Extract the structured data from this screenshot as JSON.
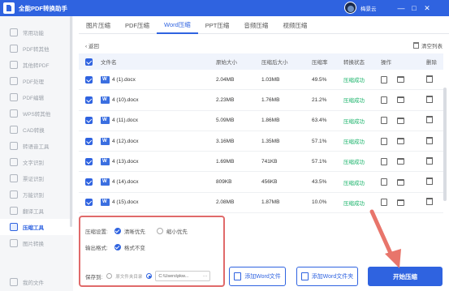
{
  "app": {
    "title": "全能PDF转换助手",
    "username": "梅景云"
  },
  "window": {
    "buttons": [
      "—",
      "□",
      "✕"
    ]
  },
  "sidebar": {
    "items": [
      {
        "label": "常用功能",
        "active": false
      },
      {
        "label": "PDF转其他",
        "active": false
      },
      {
        "label": "其他转PDF",
        "active": false
      },
      {
        "label": "PDF处理",
        "active": false
      },
      {
        "label": "PDF编辑",
        "active": false
      },
      {
        "label": "WPS转其他",
        "active": false
      },
      {
        "label": "CAD转换",
        "active": false
      },
      {
        "label": "转语音工具",
        "active": false
      },
      {
        "label": "文字识别",
        "active": false
      },
      {
        "label": "票证识别",
        "active": false
      },
      {
        "label": "万能识别",
        "active": false
      },
      {
        "label": "翻译工具",
        "active": false
      },
      {
        "label": "压缩工具",
        "active": true
      },
      {
        "label": "图片转换",
        "active": false
      }
    ],
    "bottom": "我的文件"
  },
  "tabs": [
    {
      "label": "图片压缩",
      "active": false
    },
    {
      "label": "PDF压缩",
      "active": false
    },
    {
      "label": "Word压缩",
      "active": true
    },
    {
      "label": "PPT压缩",
      "active": false
    },
    {
      "label": "音频压缩",
      "active": false
    },
    {
      "label": "视频压缩",
      "active": false
    }
  ],
  "subbar": {
    "back": "‹ 返回",
    "clear": "清空列表"
  },
  "table": {
    "headers": {
      "name": "文件名",
      "orig": "原始大小",
      "after": "压缩后大小",
      "rate": "压缩率",
      "status": "转换状态",
      "op": "操作",
      "del": "删除"
    },
    "rows": [
      {
        "name": "4 (1).docx",
        "orig": "2.04MB",
        "after": "1.03MB",
        "rate": "49.5%",
        "status": "压缩成功"
      },
      {
        "name": "4 (10).docx",
        "orig": "2.23MB",
        "after": "1.76MB",
        "rate": "21.2%",
        "status": "压缩成功"
      },
      {
        "name": "4 (11).docx",
        "orig": "5.09MB",
        "after": "1.86MB",
        "rate": "63.4%",
        "status": "压缩成功"
      },
      {
        "name": "4 (12).docx",
        "orig": "3.16MB",
        "after": "1.35MB",
        "rate": "57.1%",
        "status": "压缩成功"
      },
      {
        "name": "4 (13).docx",
        "orig": "1.69MB",
        "after": "741KB",
        "rate": "57.1%",
        "status": "压缩成功"
      },
      {
        "name": "4 (14).docx",
        "orig": "809KB",
        "after": "456KB",
        "rate": "43.5%",
        "status": "压缩成功"
      },
      {
        "name": "4 (15).docx",
        "orig": "2.08MB",
        "after": "1.87MB",
        "rate": "10.0%",
        "status": "压缩成功"
      }
    ]
  },
  "settings": {
    "mode_label": "压缩设置:",
    "mode_options": [
      "清晰优先",
      "缩小优先"
    ],
    "format_label": "输出格式:",
    "format_option": "格式不变",
    "save_label": "保存到:",
    "save_original": "原文件夹目录",
    "save_path": "C:\\Users\\pkw..."
  },
  "buttons": {
    "add_file": "添加Word文件",
    "add_folder": "添加Word文件夹",
    "start": "开始压缩"
  }
}
